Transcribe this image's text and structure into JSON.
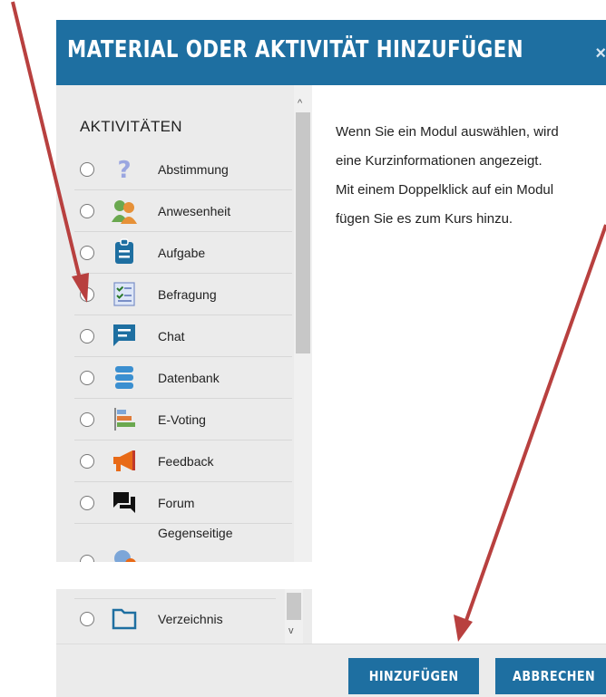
{
  "dialog": {
    "title": "MATERIAL ODER AKTIVITÄT HINZUFÜGEN",
    "close_symbol": "×"
  },
  "activities": {
    "section_title": "AKTIVITÄTEN",
    "items": [
      {
        "label": "Abstimmung",
        "icon": "question-icon"
      },
      {
        "label": "Anwesenheit",
        "icon": "people-icon"
      },
      {
        "label": "Aufgabe",
        "icon": "clipboard-icon"
      },
      {
        "label": "Befragung",
        "icon": "checklist-icon"
      },
      {
        "label": "Chat",
        "icon": "chat-bubble-icon"
      },
      {
        "label": "Datenbank",
        "icon": "database-icon"
      },
      {
        "label": "E-Voting",
        "icon": "bar-chart-icon"
      },
      {
        "label": "Feedback",
        "icon": "megaphone-icon"
      },
      {
        "label": "Forum",
        "icon": "forum-icon"
      },
      {
        "label": "Gegenseitige",
        "icon": "workshop-icon"
      }
    ],
    "last_item": {
      "label": "Verzeichnis",
      "icon": "folder-icon"
    }
  },
  "info": {
    "lines": [
      "Wenn Sie ein Modul auswählen, wird",
      "eine Kurzinformationen angezeigt.",
      "Mit einem Doppelklick auf ein Modul",
      "fügen Sie es zum Kurs hinzu."
    ]
  },
  "footer": {
    "add_label": "HINZUFÜGEN",
    "cancel_label": "ABBRECHEN"
  },
  "colors": {
    "brand": "#1e6fa1",
    "arrow": "#b8403f"
  }
}
